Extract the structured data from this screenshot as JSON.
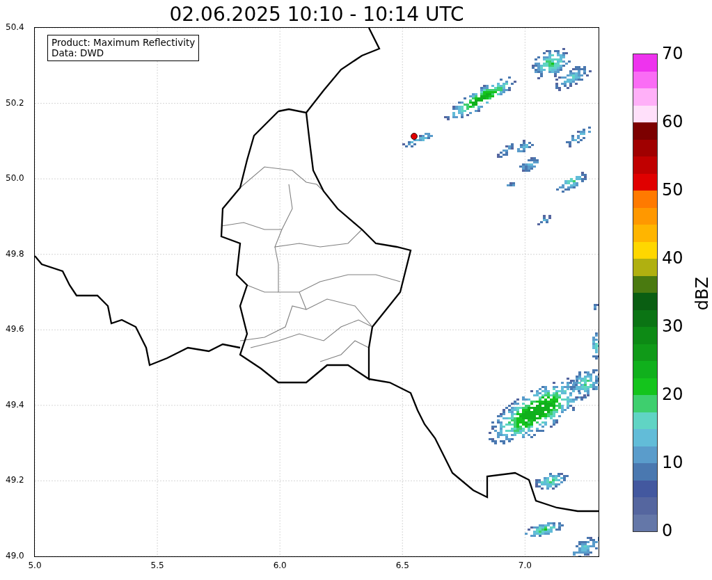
{
  "title": "02.06.2025 10:10 - 10:14 UTC",
  "legend": [
    "Product: Maximum Reflectivity",
    "Data: DWD"
  ],
  "x_ticks": [
    "5.0",
    "5.5",
    "6.0",
    "6.5",
    "7.0"
  ],
  "y_ticks": [
    "50.4",
    "50.2",
    "50.0",
    "49.8",
    "49.6",
    "49.4",
    "49.2",
    "49.0"
  ],
  "colorbar": {
    "label": "dBZ",
    "ticks": [
      "70",
      "60",
      "50",
      "40",
      "30",
      "20",
      "10",
      "0"
    ],
    "segments": [
      {
        "color": "#6477a8"
      },
      {
        "color": "#55669f"
      },
      {
        "color": "#43589f"
      },
      {
        "color": "#4a78b0"
      },
      {
        "color": "#5a9ccb"
      },
      {
        "color": "#62bcd8"
      },
      {
        "color": "#60d4c4"
      },
      {
        "color": "#3ecf6e"
      },
      {
        "color": "#14c41c"
      },
      {
        "color": "#10b01c"
      },
      {
        "color": "#109a18"
      },
      {
        "color": "#0d8a15"
      },
      {
        "color": "#0b7414"
      },
      {
        "color": "#0a5e12"
      },
      {
        "color": "#4a7a10"
      },
      {
        "color": "#b0b010"
      },
      {
        "color": "#ffd700"
      },
      {
        "color": "#ffb500"
      },
      {
        "color": "#ff9800"
      },
      {
        "color": "#ff7a00"
      },
      {
        "color": "#e00000"
      },
      {
        "color": "#c00000"
      },
      {
        "color": "#a00000"
      },
      {
        "color": "#7c0000"
      },
      {
        "color": "#ffe0fa"
      },
      {
        "color": "#ffb0f8"
      },
      {
        "color": "#fa6cf5"
      },
      {
        "color": "#ee33ee"
      }
    ]
  }
}
